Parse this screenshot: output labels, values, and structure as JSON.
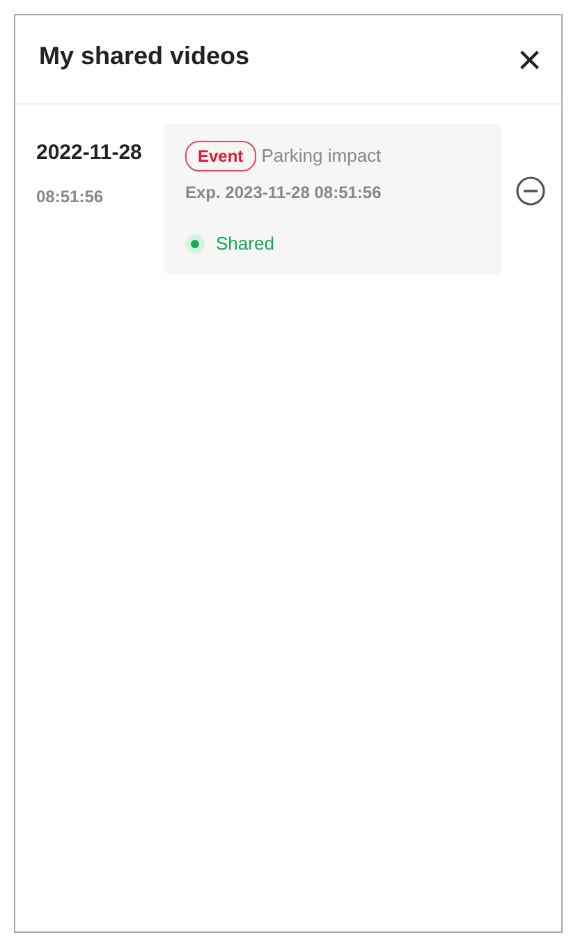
{
  "dialog": {
    "title": "My shared videos",
    "close": "×"
  },
  "videos": [
    {
      "date": "2022-11-28",
      "time": "08:51:56",
      "tag": "Event",
      "description": "Parking impact",
      "expiry": "Exp. 2023-11-28 08:51:56",
      "status": {
        "kind": "shared",
        "label": "Shared"
      }
    }
  ]
}
